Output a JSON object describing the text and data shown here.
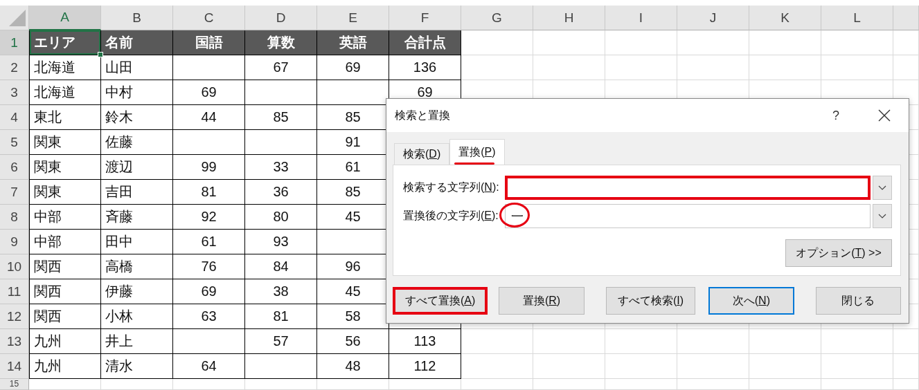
{
  "sheet": {
    "columns": [
      {
        "label": "A",
        "selected": true
      },
      {
        "label": "B",
        "selected": false
      },
      {
        "label": "C",
        "selected": false
      },
      {
        "label": "D",
        "selected": false
      },
      {
        "label": "E",
        "selected": false
      },
      {
        "label": "F",
        "selected": false
      },
      {
        "label": "G",
        "selected": false
      },
      {
        "label": "H",
        "selected": false
      },
      {
        "label": "I",
        "selected": false
      },
      {
        "label": "J",
        "selected": false
      },
      {
        "label": "K",
        "selected": false
      },
      {
        "label": "L",
        "selected": false
      }
    ],
    "rows": [
      {
        "label": "1",
        "selected": true,
        "kind": "header",
        "cells": [
          "エリア",
          "名前",
          "国語",
          "算数",
          "英語",
          "合計点"
        ]
      },
      {
        "label": "2",
        "selected": false,
        "kind": "data",
        "cells": [
          "北海道",
          "山田",
          null,
          "67",
          "69",
          "136"
        ]
      },
      {
        "label": "3",
        "selected": false,
        "kind": "data",
        "cells": [
          "北海道",
          "中村",
          "69",
          null,
          null,
          "69"
        ]
      },
      {
        "label": "4",
        "selected": false,
        "kind": "data",
        "cells": [
          "東北",
          "鈴木",
          "44",
          "85",
          "85",
          null
        ]
      },
      {
        "label": "5",
        "selected": false,
        "kind": "data",
        "cells": [
          "関東",
          "佐藤",
          null,
          null,
          "91",
          null
        ]
      },
      {
        "label": "6",
        "selected": false,
        "kind": "data",
        "cells": [
          "関東",
          "渡辺",
          "99",
          "33",
          "61",
          null
        ]
      },
      {
        "label": "7",
        "selected": false,
        "kind": "data",
        "cells": [
          "関東",
          "吉田",
          "81",
          "36",
          "85",
          null
        ]
      },
      {
        "label": "8",
        "selected": false,
        "kind": "data",
        "cells": [
          "中部",
          "斉藤",
          "92",
          "80",
          "45",
          null
        ]
      },
      {
        "label": "9",
        "selected": false,
        "kind": "data",
        "cells": [
          "中部",
          "田中",
          "61",
          "93",
          null,
          null
        ]
      },
      {
        "label": "10",
        "selected": false,
        "kind": "data",
        "cells": [
          "関西",
          "高橋",
          "76",
          "84",
          "96",
          null
        ]
      },
      {
        "label": "11",
        "selected": false,
        "kind": "data",
        "cells": [
          "関西",
          "伊藤",
          "69",
          "38",
          "45",
          null
        ]
      },
      {
        "label": "12",
        "selected": false,
        "kind": "data",
        "cells": [
          "関西",
          "小林",
          "63",
          "81",
          "58",
          null
        ]
      },
      {
        "label": "13",
        "selected": false,
        "kind": "data",
        "cells": [
          "九州",
          "井上",
          null,
          "57",
          "56",
          "113"
        ]
      },
      {
        "label": "14",
        "selected": false,
        "kind": "data",
        "cells": [
          "九州",
          "清水",
          "64",
          null,
          "48",
          "112"
        ]
      },
      {
        "label": "15",
        "selected": false,
        "kind": "empty"
      }
    ]
  },
  "dialog": {
    "title": "検索と置換",
    "help": "?",
    "tabs": [
      {
        "text_before": "検索(",
        "access_key": "D",
        "text_after": ")",
        "selected": false,
        "underlined": false
      },
      {
        "text_before": "置換(",
        "access_key": "P",
        "text_after": ")",
        "selected": true,
        "underlined": true
      }
    ],
    "fields": [
      {
        "text_before": "検索する文字列(",
        "access_key": "N",
        "text_after": "):",
        "boxed": true,
        "circled": false
      },
      {
        "text_before": "置換後の文字列(",
        "access_key": "E",
        "text_after": "):",
        "value": "一",
        "boxed": false,
        "circled": true
      }
    ],
    "options_button": {
      "text_before": "オプション(",
      "access_key": "T",
      "text_after": ") >>"
    },
    "buttons": [
      {
        "text_before": "すべて置換(",
        "access_key": "A",
        "text_after": ")",
        "default": false,
        "boxed": true
      },
      {
        "text_before": "置換(",
        "access_key": "R",
        "text_after": ")",
        "default": false,
        "boxed": false
      },
      {
        "text_before": "すべて検索(",
        "access_key": "I",
        "text_after": ")",
        "default": false,
        "boxed": false
      },
      {
        "text_before": "次へ(",
        "access_key": "N",
        "text_after": ")",
        "default": true,
        "boxed": false
      },
      {
        "text_before": "閉じる",
        "default": false,
        "boxed": false
      }
    ]
  }
}
